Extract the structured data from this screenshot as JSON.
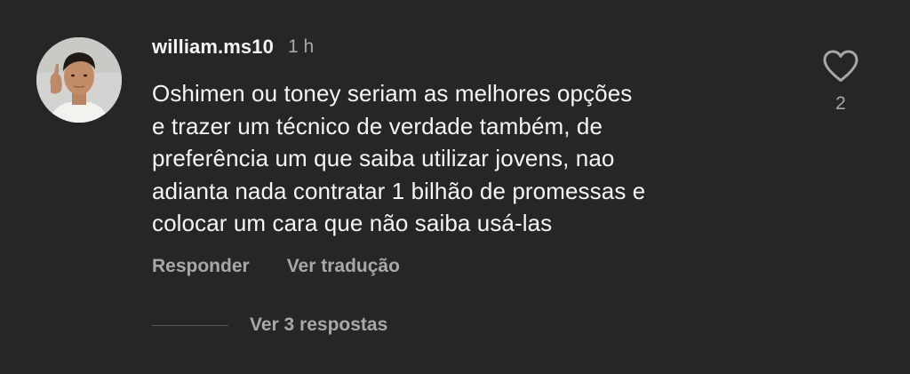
{
  "comment": {
    "username": "william.ms10",
    "timestamp": "1 h",
    "text_lines": [
      "Oshimen ou toney seriam as melhores opções",
      "e trazer um técnico de verdade também, de",
      "preferência um que saiba utilizar jovens, nao",
      "adianta nada contratar 1 bilhão de promessas e",
      "colocar um cara que não saiba usá-las"
    ],
    "actions": {
      "reply_label": "Responder",
      "translate_label": "Ver tradução"
    },
    "likes": {
      "icon": "heart-outline-icon",
      "count": "2"
    },
    "replies": {
      "label": "Ver 3 respostas"
    },
    "avatar": {
      "icon": "user-avatar-photo"
    }
  },
  "colors": {
    "background": "#262626",
    "primary_text": "#f5f5f5",
    "secondary_text": "#a8a8a8",
    "divider": "#555555"
  }
}
